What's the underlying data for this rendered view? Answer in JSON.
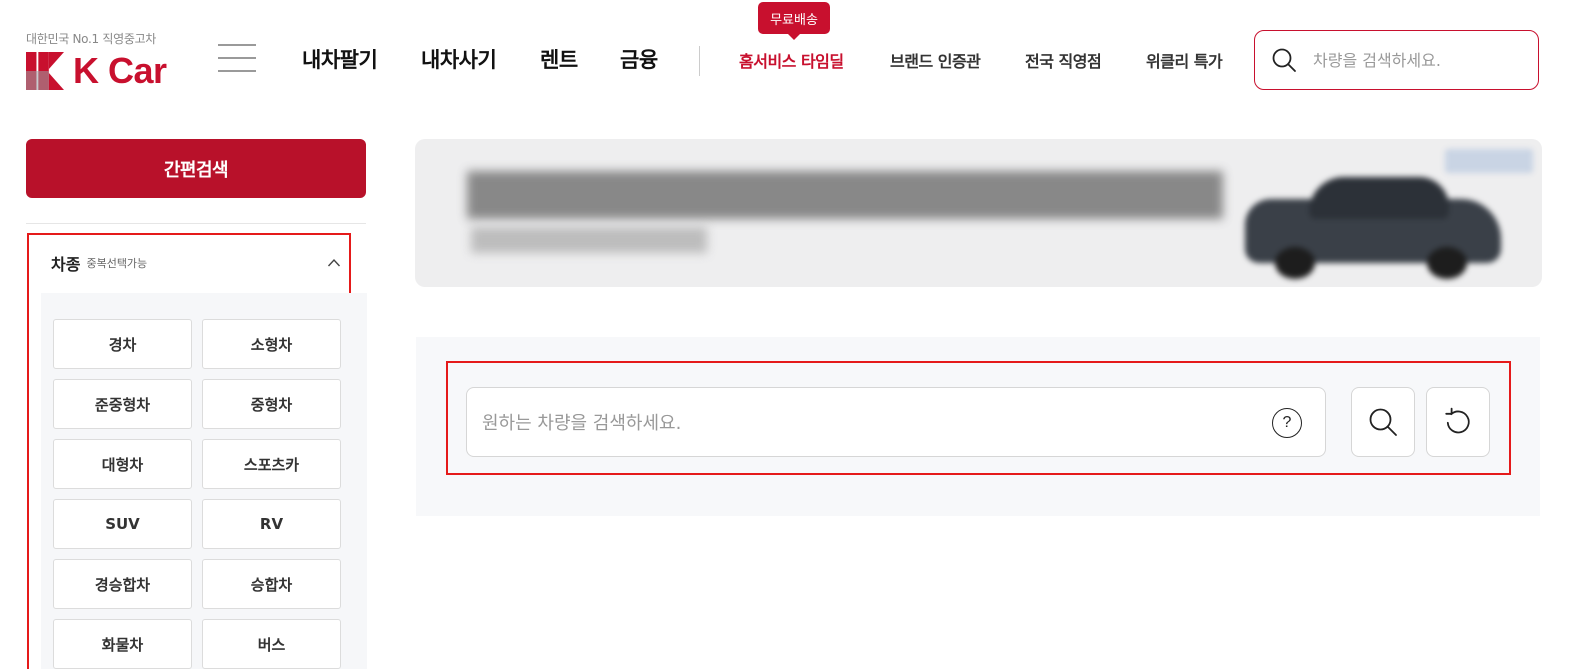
{
  "header": {
    "logo": {
      "tagline": "대한민국 No.1 직영중고차",
      "name": "K Car"
    },
    "nav_main": [
      "내차팔기",
      "내차사기",
      "렌트",
      "금융"
    ],
    "nav_sub": [
      "홈서비스 타임딜",
      "브랜드 인증관",
      "전국 직영점",
      "위클리 특가"
    ],
    "promo_badge": "무료배송",
    "search": {
      "placeholder": "차량을 검색하세요."
    }
  },
  "sidebar": {
    "quick_search_label": "간편검색",
    "filter": {
      "title": "차종",
      "subtitle": "중복선택가능",
      "options": [
        "경차",
        "소형차",
        "준중형차",
        "중형차",
        "대형차",
        "스포츠카",
        "SUV",
        "RV",
        "경승합차",
        "승합차",
        "화물차",
        "버스"
      ]
    }
  },
  "main": {
    "search": {
      "placeholder": "원하는 차량을 검색하세요.",
      "help_symbol": "?"
    }
  },
  "icons": {
    "hamburger": "menu-icon",
    "header_search": "search-icon",
    "chevron": "chevron-up-icon",
    "main_search": "search-icon",
    "reset": "refresh-icon",
    "help": "help-icon"
  },
  "colors": {
    "brand": "#c8102e",
    "quick_search": "#b8112a",
    "highlight_outline": "#e51a1a",
    "section_bg": "#f7f8fa"
  }
}
